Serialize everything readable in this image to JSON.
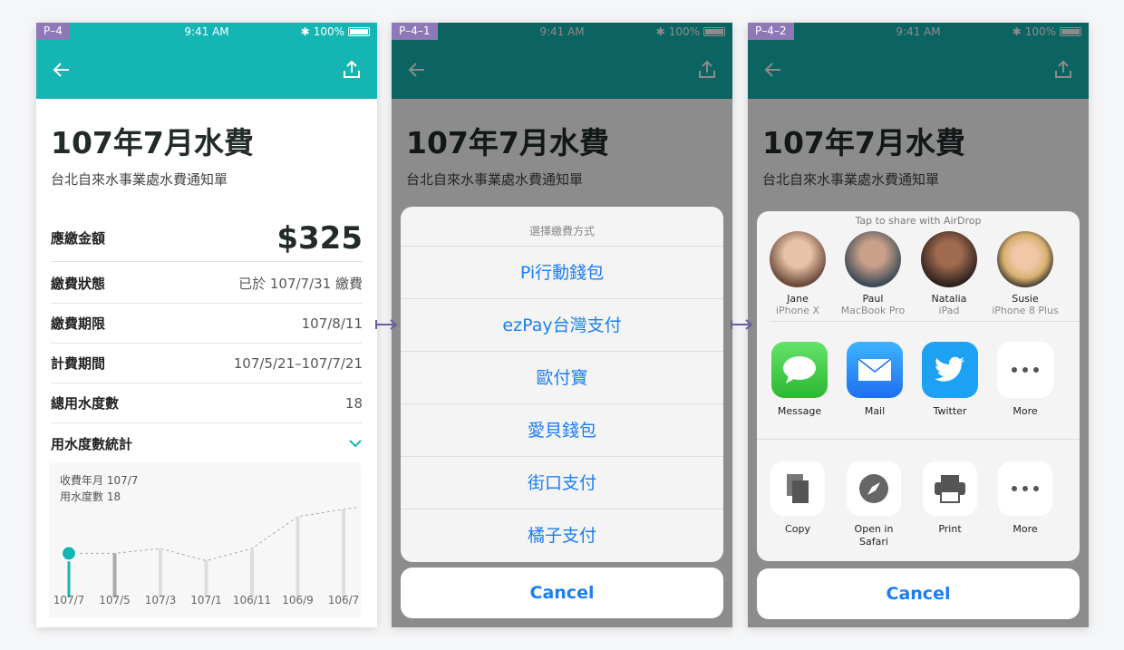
{
  "screens": [
    {
      "tag": "P–4",
      "status": {
        "time": "9:41 AM",
        "battery": "100%"
      },
      "title": "107年7月水費",
      "subtitle": "台北自來水事業處水費通知單",
      "rows": [
        {
          "key": "應繳金額",
          "value": "$325"
        },
        {
          "key": "繳費狀態",
          "value": "已於 107/7/31 繳費"
        },
        {
          "key": "繳費期限",
          "value": "107/8/11"
        },
        {
          "key": "計費期間",
          "value": "107/5/21–107/7/21"
        },
        {
          "key": "總用水度數",
          "value": "18"
        },
        {
          "key": "用水度數統計",
          "value": ""
        }
      ],
      "chart_info": [
        "收費年月 107/7",
        "用水度數 18"
      ]
    },
    {
      "tag": "P–4–1",
      "status": {
        "time": "9:41 AM",
        "battery": "100%"
      },
      "sheet_title": "選擇繳費方式",
      "options": [
        "Pi行動錢包",
        "ezPay台灣支付",
        "歐付寶",
        "愛貝錢包",
        "街口支付",
        "橘子支付"
      ],
      "cancel": "Cancel"
    },
    {
      "tag": "P–4–2",
      "status": {
        "time": "9:41 AM",
        "battery": "100%"
      },
      "airdrop_title": "Tap to share with AirDrop",
      "people": [
        {
          "name": "Jane",
          "device": "iPhone X"
        },
        {
          "name": "Paul",
          "device": "MacBook Pro"
        },
        {
          "name": "Natalia",
          "device": "iPad"
        },
        {
          "name": "Susie",
          "device": "iPhone 8 Plus"
        }
      ],
      "share_apps": [
        "Message",
        "Mail",
        "Twitter",
        "More"
      ],
      "actions": [
        "Copy",
        "Open in Safari",
        "Print",
        "More"
      ],
      "cancel": "Cancel"
    }
  ],
  "chart_data": {
    "type": "line",
    "categories": [
      "107/7",
      "107/5",
      "107/3",
      "107/1",
      "106/11",
      "106/9",
      "106/7"
    ],
    "values": [
      18,
      18,
      20,
      15,
      20,
      33,
      36
    ],
    "ylim": [
      0,
      40
    ],
    "selected_index": 0,
    "accent": "#14b5b3"
  },
  "colors": {
    "primary": "#14b5b3",
    "link": "#1b7ef5"
  }
}
